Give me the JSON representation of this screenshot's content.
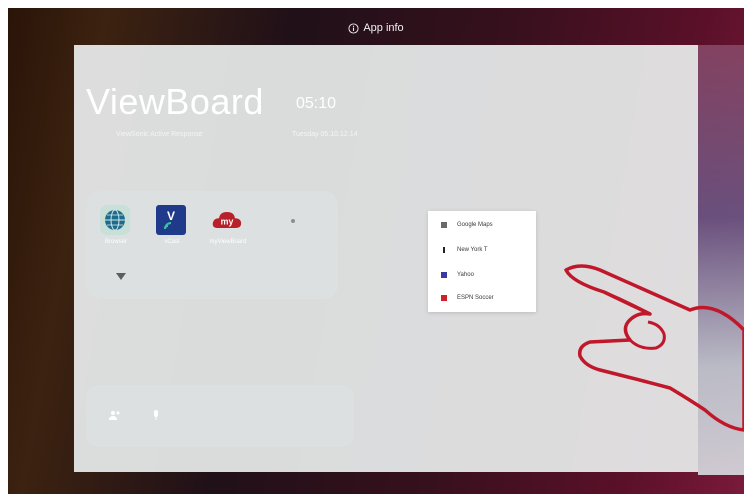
{
  "topbar": {
    "app_info_label": "App info"
  },
  "card": {
    "title": "ViewBoard",
    "clock": "05:10",
    "subtitle_left": "ViewSonic Active Response",
    "subtitle_right": "Tuesday 05.10.12.14"
  },
  "apps": [
    {
      "label": "Browser",
      "icon": "globe-icon",
      "color": "#3a9a8a"
    },
    {
      "label": "vCast",
      "icon": "vcast-icon",
      "color": "#1f3a8a"
    },
    {
      "label": "myViewBoard",
      "icon": "myviewboard-cloud-icon",
      "color": "#b8202a"
    }
  ],
  "context_menu": {
    "items": [
      {
        "label": "Google Maps",
        "icon": "google-maps-icon",
        "color": "#6a6a6a"
      },
      {
        "label": "New York T",
        "icon": "nyt-icon",
        "color": "#222222"
      },
      {
        "label": "Yahoo",
        "icon": "yahoo-icon",
        "color": "#3a3aa0"
      },
      {
        "label": "ESPN Soccer",
        "icon": "espn-icon",
        "color": "#d0202a"
      }
    ]
  },
  "colors": {
    "hand_outline": "#c0182a",
    "menu_background": "#ffffff",
    "card_background": "#e8ecec"
  }
}
